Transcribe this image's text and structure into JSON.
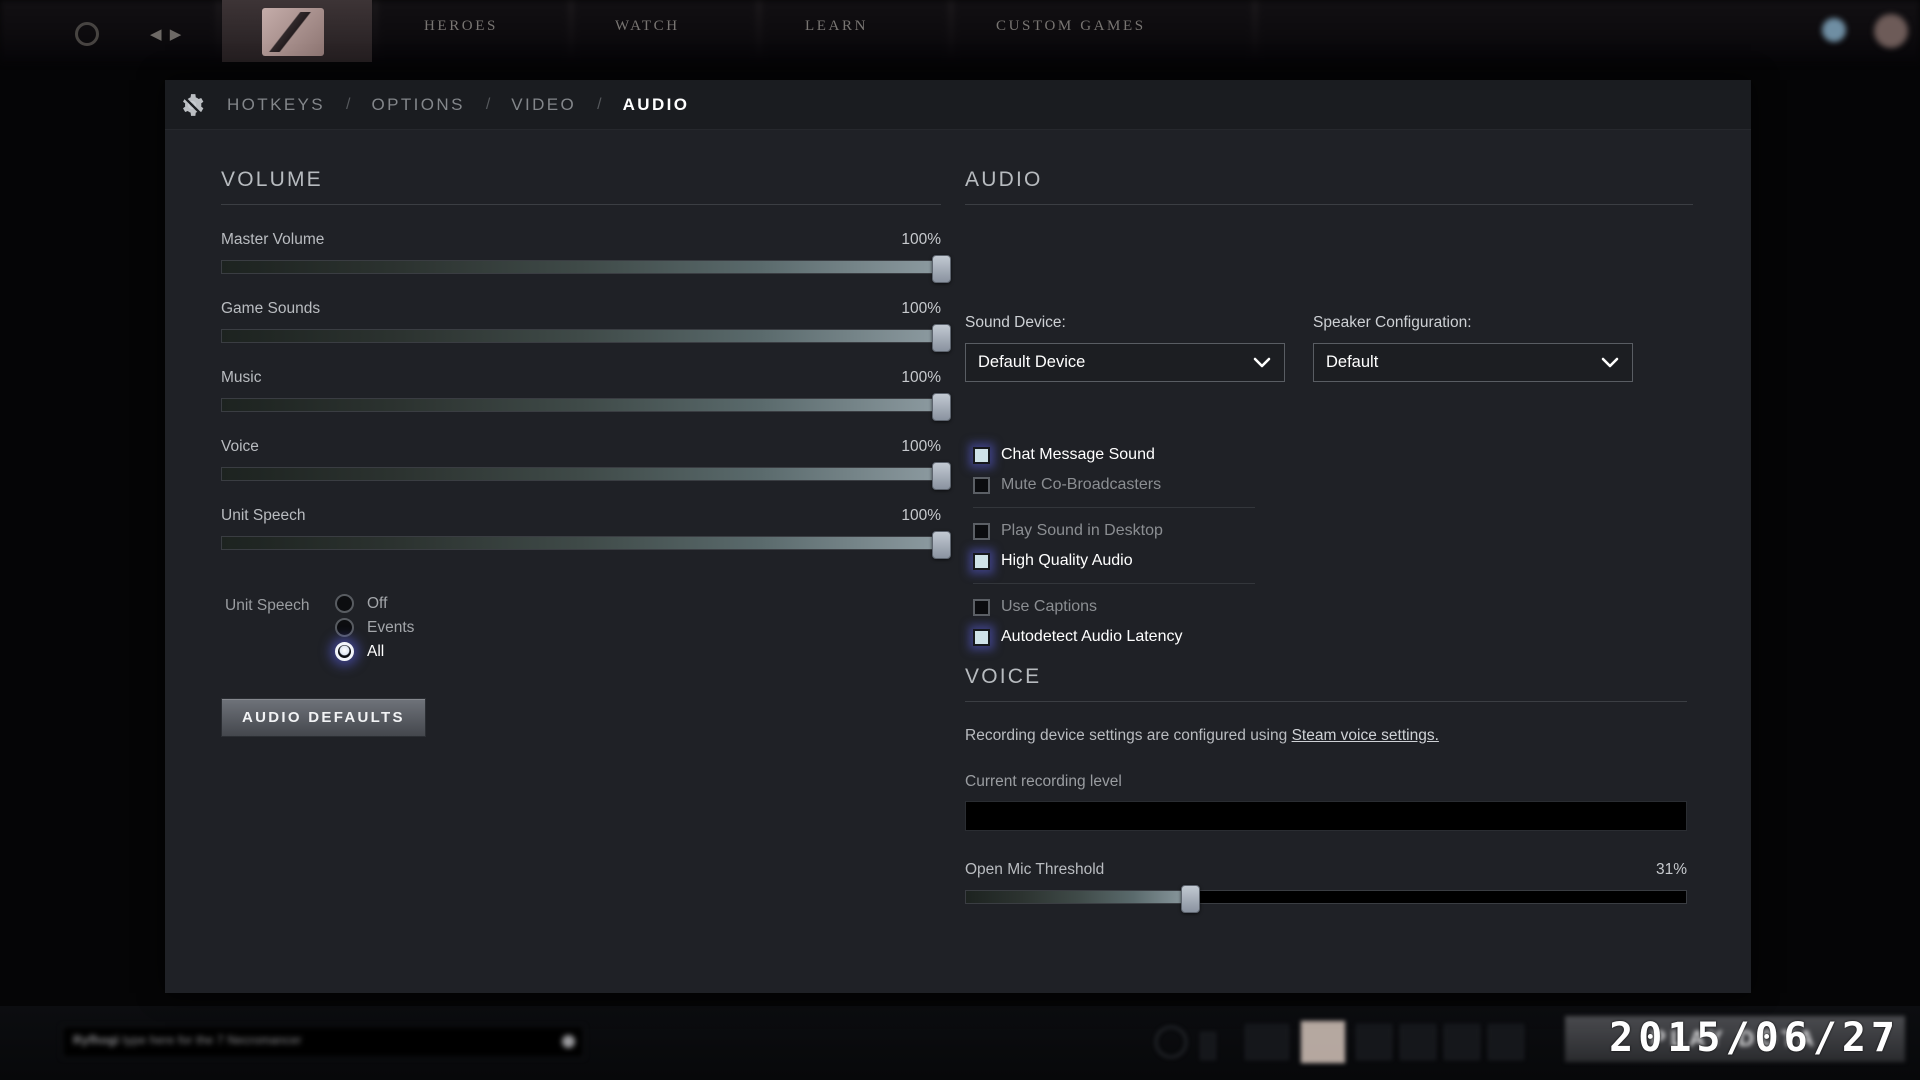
{
  "background": {
    "top_nav": {
      "gear_icon": "gear-icon",
      "arrows_icon": "back-forward-arrows-icon",
      "logo": "dota-logo-icon",
      "items": [
        "HEROES",
        "WATCH",
        "LEARN",
        "CUSTOM GAMES"
      ]
    },
    "hud": {
      "chat_prefix": "Ryfhogi",
      "chat_text": "type here for the 7 Necromancer",
      "play_button_label": "PLAY DOTA",
      "date_stamp": "2015/06/27"
    }
  },
  "settings": {
    "gear_icon": "settings-gear-icon",
    "tabs": [
      {
        "label": "HOTKEYS",
        "active": false
      },
      {
        "label": "OPTIONS",
        "active": false
      },
      {
        "label": "VIDEO",
        "active": false
      },
      {
        "label": "AUDIO",
        "active": true
      }
    ],
    "tab_separator": "/",
    "volume": {
      "heading": "VOLUME",
      "sliders": [
        {
          "label": "Master Volume",
          "value": "100%",
          "percent": 100
        },
        {
          "label": "Game Sounds",
          "value": "100%",
          "percent": 100
        },
        {
          "label": "Music",
          "value": "100%",
          "percent": 100
        },
        {
          "label": "Voice",
          "value": "100%",
          "percent": 100
        },
        {
          "label": "Unit Speech",
          "value": "100%",
          "percent": 100
        }
      ],
      "radio_group": {
        "label": "Unit Speech",
        "options": [
          {
            "label": "Off",
            "selected": false
          },
          {
            "label": "Events",
            "selected": false
          },
          {
            "label": "All",
            "selected": true
          }
        ]
      },
      "defaults_button": "AUDIO DEFAULTS"
    },
    "audio": {
      "heading": "AUDIO",
      "sound_device": {
        "label": "Sound Device:",
        "value": "Default Device",
        "chevron_icon": "chevron-down-icon"
      },
      "speaker_config": {
        "label": "Speaker Configuration:",
        "value": "Default",
        "chevron_icon": "chevron-down-icon"
      },
      "checkbox_groups": [
        [
          {
            "label": "Chat Message Sound",
            "checked": true
          },
          {
            "label": "Mute Co-Broadcasters",
            "checked": false
          }
        ],
        [
          {
            "label": "Play Sound in Desktop",
            "checked": false
          },
          {
            "label": "High Quality Audio",
            "checked": true
          }
        ],
        [
          {
            "label": "Use Captions",
            "checked": false
          },
          {
            "label": "Autodetect Audio Latency",
            "checked": true
          }
        ]
      ]
    },
    "voice": {
      "heading": "VOICE",
      "description_prefix": "Recording device settings are configured using ",
      "description_link": "Steam voice settings.",
      "recording_level_label": "Current recording level",
      "open_mic": {
        "label": "Open Mic Threshold",
        "value": "31%",
        "percent": 31
      }
    }
  },
  "colors": {
    "panel_bg": "#1f2126",
    "tabbar_bg": "#1a1c20",
    "accent_glow": "#5c60de",
    "checked_fill": "#cfe2e8",
    "active_tab": "#ffffff"
  }
}
